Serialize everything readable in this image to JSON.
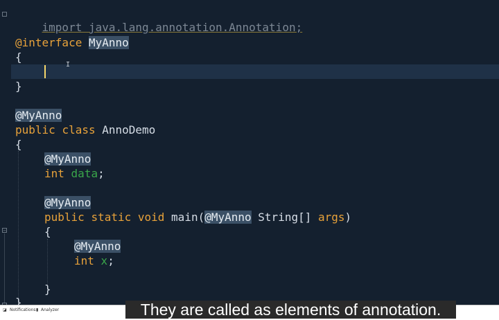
{
  "editor": {
    "lines": {
      "import": "import java.lang.annotation.Annotation;",
      "iface_kw": "@interface",
      "iface_name": "MyAnno",
      "brace_open1": "{",
      "brace_close1": "}",
      "ann_at1": "@",
      "ann_name1": "MyAnno",
      "class_kw1": "public",
      "class_kw2": "class",
      "class_name": "AnnoDemo",
      "brace_open2": "{",
      "ann_at2": "@",
      "ann_name2": "MyAnno",
      "field_type": "int",
      "field_name": "data",
      "field_semi": ";",
      "ann_at3": "@",
      "ann_name3": "MyAnno",
      "m_public": "public",
      "m_static": "static",
      "m_void": "void",
      "m_name": "main(",
      "m_at": "@",
      "m_ann": "MyAnno",
      "m_type": " String[] ",
      "m_param": "args",
      "m_close": ")",
      "brace_open3": "{",
      "ann_at4": "@",
      "ann_name4": "MyAnno",
      "local_type": "int",
      "local_name": "x",
      "local_semi": ";",
      "brace_close3": "}",
      "brace_close_partial": "}"
    }
  },
  "statusbar": {
    "notifications": "Notifications",
    "analyzer": "Analyzer"
  },
  "caption": {
    "text": "They are called as elements of annotation."
  }
}
